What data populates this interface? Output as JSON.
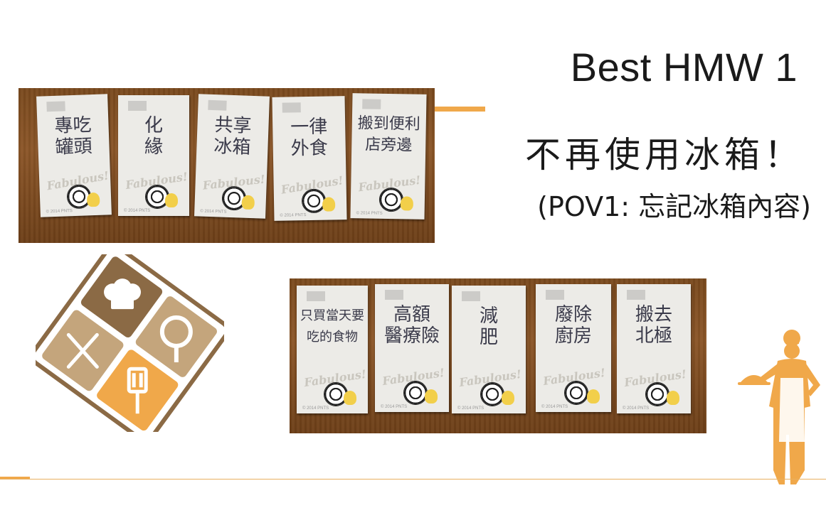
{
  "slide": {
    "title": "Best HMW 1",
    "subtitle": "不再使用冰箱！",
    "pov": "(POV1: 忘記冰箱內容)"
  },
  "photos": {
    "top": {
      "cards": [
        {
          "text": "專吃\n罐頭"
        },
        {
          "text": "化\n緣"
        },
        {
          "text": "共享\n冰箱"
        },
        {
          "text": "一律\n外食"
        },
        {
          "text": "搬到便利\n店旁邊"
        }
      ],
      "card_brand": "Fabulous!",
      "card_copyright": "© 2014 PNTS"
    },
    "bottom": {
      "cards": [
        {
          "text": "只買當天要\n吃的食物"
        },
        {
          "text": "高額\n醫療險"
        },
        {
          "text": "減\n肥"
        },
        {
          "text": "廢除\n廚房"
        },
        {
          "text": "搬去\n北極"
        }
      ],
      "card_brand": "Fabulous!",
      "card_copyright": "© 2014 PNTS"
    }
  },
  "decor": {
    "logo_icons": [
      "chef-hat-icon",
      "frying-pan-icon",
      "fork-knife-icon",
      "spatula-icon"
    ],
    "chef_icon": "chef-serving-icon"
  },
  "colors": {
    "accent": "#f0a84a",
    "logo_brown": "#8b6a45",
    "logo_tan": "#c4a57c"
  }
}
